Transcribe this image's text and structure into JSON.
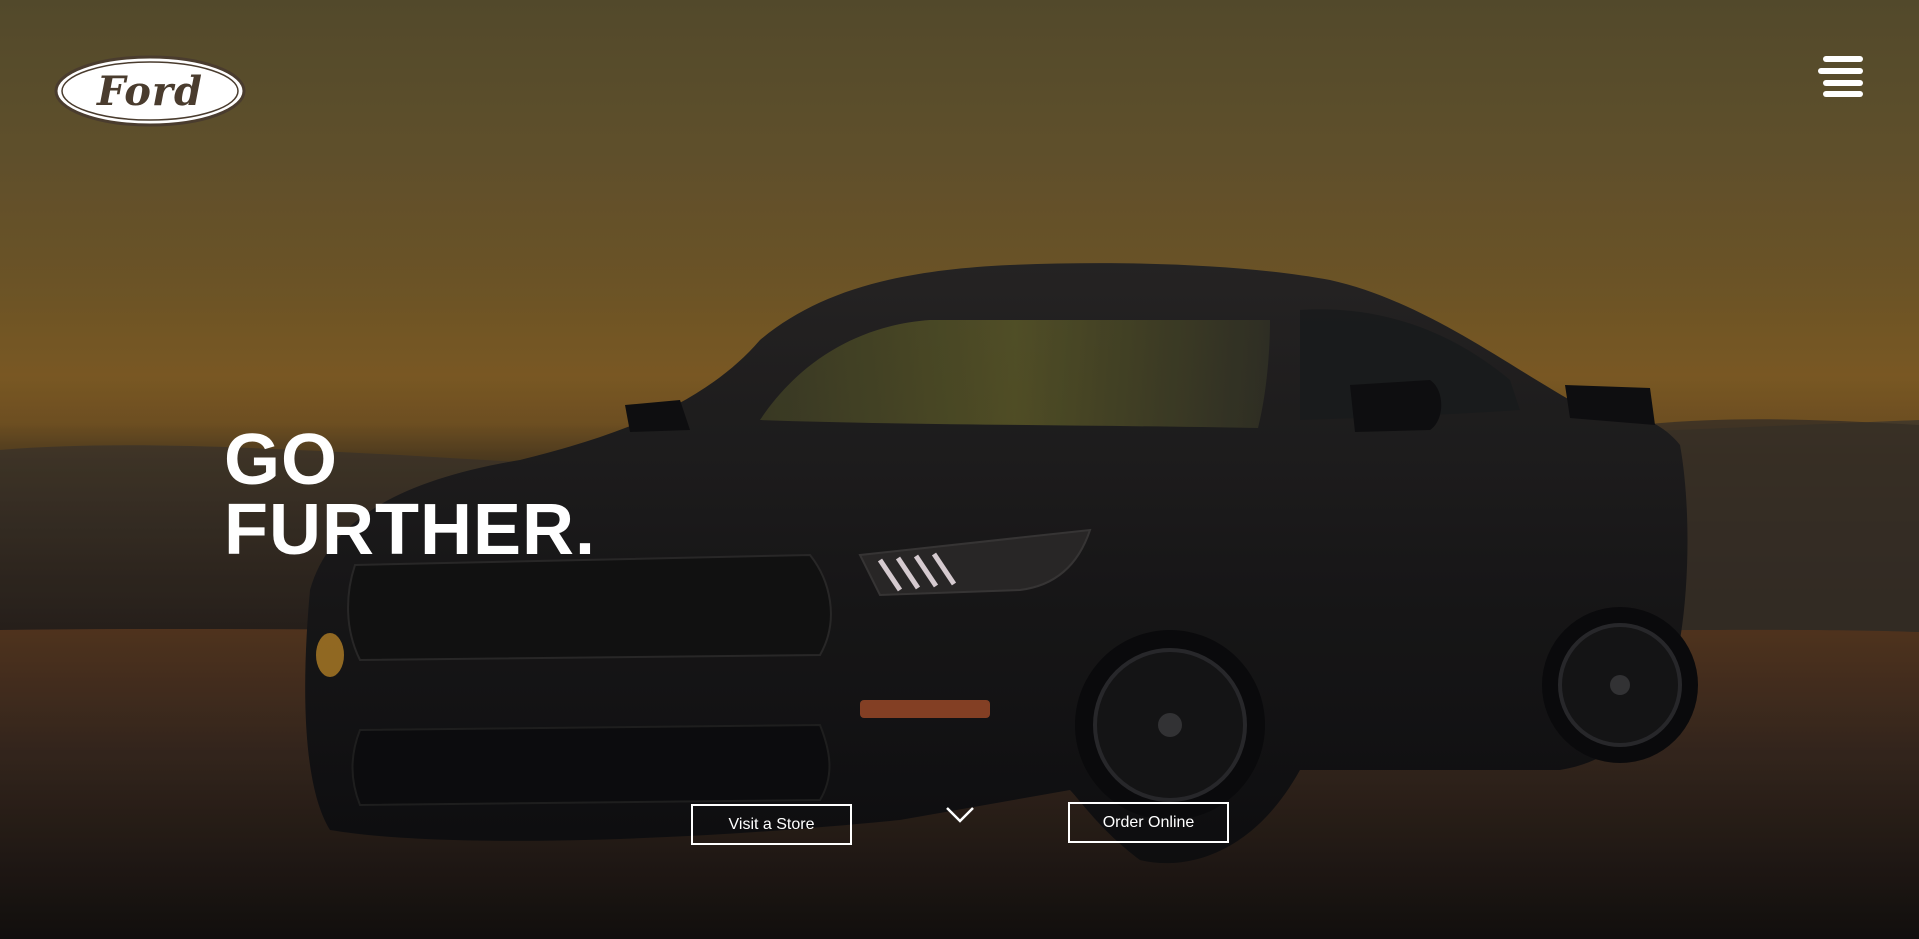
{
  "brand": {
    "logo_text": "Ford",
    "logo_color": "#4a3c2e"
  },
  "nav": {
    "menu_icon": "hamburger-menu-icon"
  },
  "hero": {
    "headline_line1": "GO",
    "headline_line2": "FURTHER.",
    "scroll_icon": "chevron-down-icon"
  },
  "actions": {
    "visit_store_label": "Visit a Store",
    "order_online_label": "Order Online"
  },
  "colors": {
    "sky_top": "#5e5432",
    "sky_horizon": "#8a6428",
    "ground": "#1d1816",
    "text": "#ffffff"
  }
}
